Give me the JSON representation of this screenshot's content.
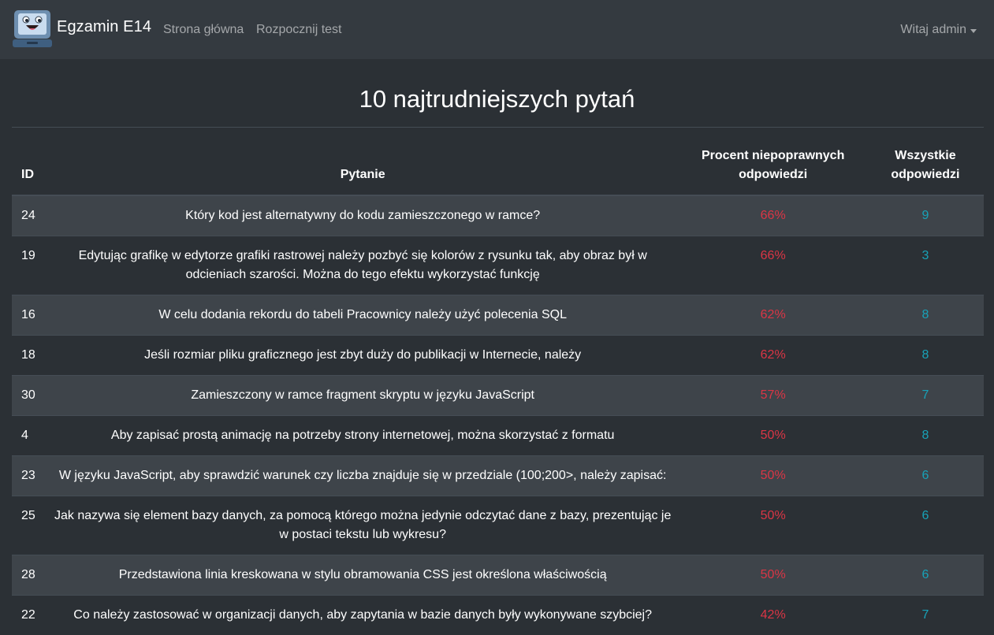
{
  "navbar": {
    "brand": "Egzamin E14",
    "links": [
      "Strona główna",
      "Rozpocznij test"
    ],
    "user": "Witaj admin"
  },
  "page": {
    "title": "10 najtrudniejszych pytań"
  },
  "table": {
    "headers": {
      "id": "ID",
      "question": "Pytanie",
      "percent": "Procent niepoprawnych odpowiedzi",
      "answers": "Wszystkie odpowiedzi"
    },
    "rows": [
      {
        "id": "24",
        "question": "Który kod jest alternatywny do kodu zamieszczonego w ramce?",
        "percent": "66%",
        "answers": "9"
      },
      {
        "id": "19",
        "question": "Edytując grafikę w edytorze grafiki rastrowej należy pozbyć się kolorów z rysunku tak, aby obraz był w odcieniach szarości. Można do tego efektu wykorzystać funkcję",
        "percent": "66%",
        "answers": "3"
      },
      {
        "id": "16",
        "question": "W celu dodania rekordu do tabeli Pracownicy należy użyć polecenia SQL",
        "percent": "62%",
        "answers": "8"
      },
      {
        "id": "18",
        "question": "Jeśli rozmiar pliku graficznego jest zbyt duży do publikacji w Internecie, należy",
        "percent": "62%",
        "answers": "8"
      },
      {
        "id": "30",
        "question": "Zamieszczony w ramce fragment skryptu w języku JavaScript",
        "percent": "57%",
        "answers": "7"
      },
      {
        "id": "4",
        "question": "Aby zapisać prostą animację na potrzeby strony internetowej, można skorzystać z formatu",
        "percent": "50%",
        "answers": "8"
      },
      {
        "id": "23",
        "question": "W języku JavaScript, aby sprawdzić warunek czy liczba znajduje się w przedziale (100;200>, należy zapisać:",
        "percent": "50%",
        "answers": "6"
      },
      {
        "id": "25",
        "question": "Jak nazywa się element bazy danych, za pomocą którego można jedynie odczytać dane z bazy, prezentując je w postaci tekstu lub wykresu?",
        "percent": "50%",
        "answers": "6"
      },
      {
        "id": "28",
        "question": "Przedstawiona linia kreskowana w stylu obramowania CSS jest określona właściwością",
        "percent": "50%",
        "answers": "6"
      },
      {
        "id": "22",
        "question": "Co należy zastosować w organizacji danych, aby zapytania w bazie danych były wykonywane szybciej?",
        "percent": "42%",
        "answers": "7"
      }
    ]
  },
  "colors": {
    "background": "#2b3035",
    "navbar": "#343a40",
    "striped_row": "#3e444a",
    "percent_text": "#dc3545",
    "answers_text": "#17a2b8"
  },
  "icons": {
    "logo": "laptop-mascot-icon",
    "user_menu": "caret-down-icon"
  }
}
